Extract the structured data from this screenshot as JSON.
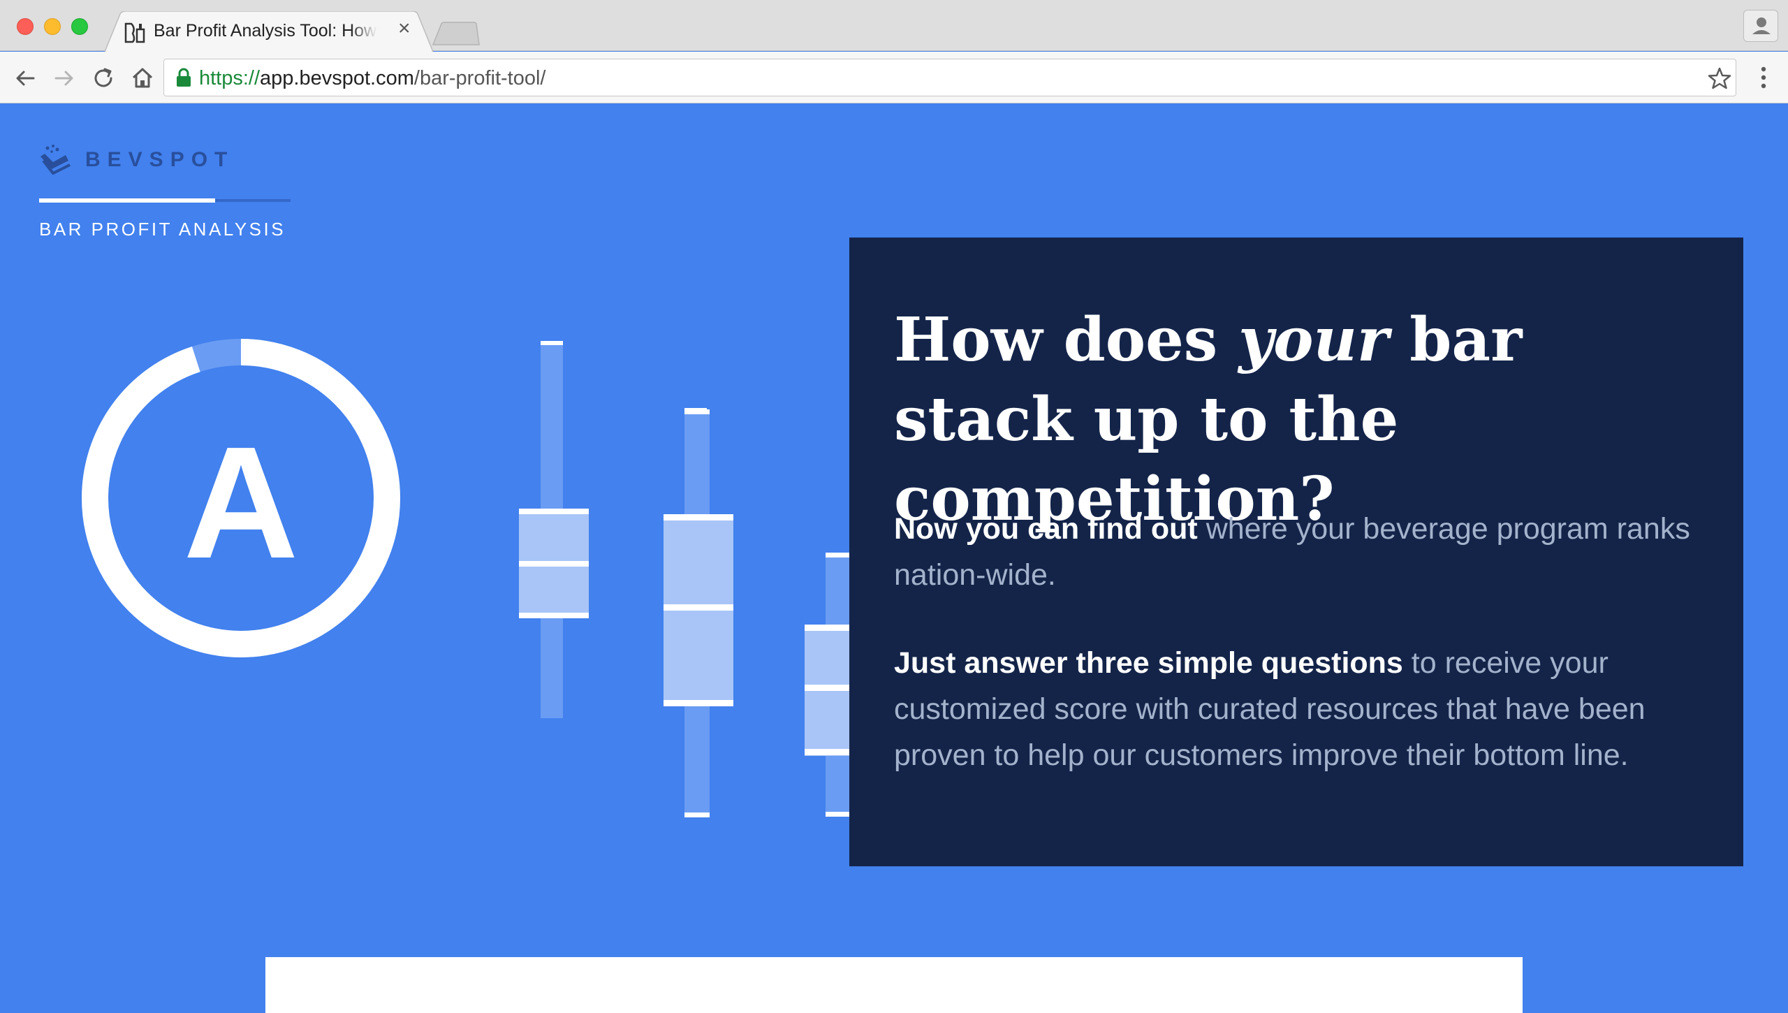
{
  "browser": {
    "tab": {
      "title": "Bar Profit Analysis Tool: How does your bar stack up",
      "close_glyph": "×",
      "favicon": "bevspot-favicon-icon"
    },
    "url": {
      "scheme": "https://",
      "host": "app.bevspot.com",
      "path": "/bar-profit-tool/"
    },
    "icons": [
      "back-icon",
      "forward-icon",
      "reload-icon",
      "home-icon",
      "lock-icon",
      "star-icon",
      "menu-icon",
      "profile-icon"
    ]
  },
  "page": {
    "logo_text": "BEVSPOT",
    "section_label": "BAR PROFIT ANALYSIS",
    "grade": "A",
    "grade_progress": 0.95,
    "headline": {
      "part1": "How does ",
      "emphasis": "your",
      "part2": " bar stack up to the competition?"
    },
    "paragraph1": {
      "bold": "Now you can find out",
      "rest": " where your beverage program ranks nation-wide."
    },
    "paragraph2": {
      "bold": "Just answer three simple questions",
      "rest": " to receive your customized score with curated resources that have been proven to help our customers improve their bottom line."
    },
    "colors": {
      "background": "#4281ee",
      "card": "#142449",
      "accent_white": "#ffffff",
      "muted_text": "#a4b3cc"
    }
  }
}
